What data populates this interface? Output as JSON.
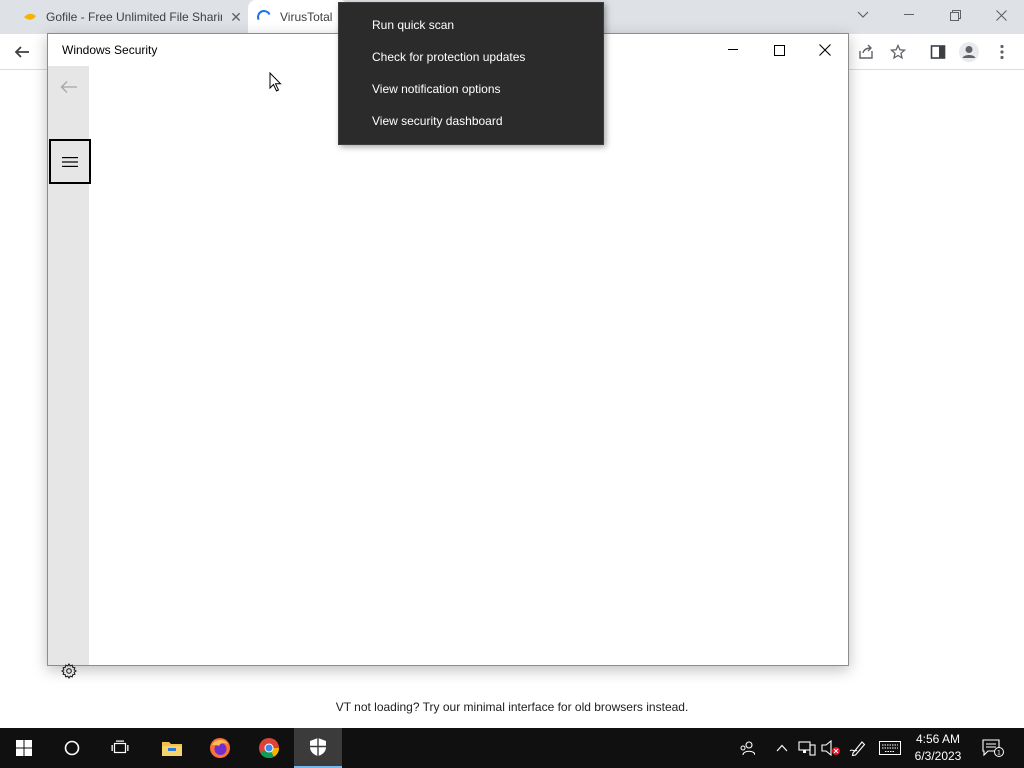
{
  "browser": {
    "tabs": [
      {
        "title": "Gofile - Free Unlimited File Sharing",
        "icon": "gofile-favicon",
        "close": "✕"
      },
      {
        "title": "VirusTotal",
        "icon": "loading-spinner-icon"
      }
    ],
    "footer_text": "VT not loading? Try our minimal interface for old browsers instead."
  },
  "context_menu": {
    "items": [
      {
        "label": "Run quick scan"
      },
      {
        "label": "Check for protection updates"
      },
      {
        "label": "View notification options"
      },
      {
        "label": "View security dashboard"
      }
    ]
  },
  "security_window": {
    "title": "Windows Security"
  },
  "taskbar": {
    "clock_time": "4:56 AM",
    "clock_date": "6/3/2023",
    "notification_count": "1",
    "pinned_apps": [
      "start",
      "search",
      "task-view",
      "file-explorer",
      "firefox",
      "chrome",
      "windows-security"
    ]
  },
  "colors": {
    "menu_bg": "#2b2b2b",
    "taskbar_bg": "#101010",
    "nav_bg": "#e6e6e6",
    "accent": "#1a73e8"
  }
}
